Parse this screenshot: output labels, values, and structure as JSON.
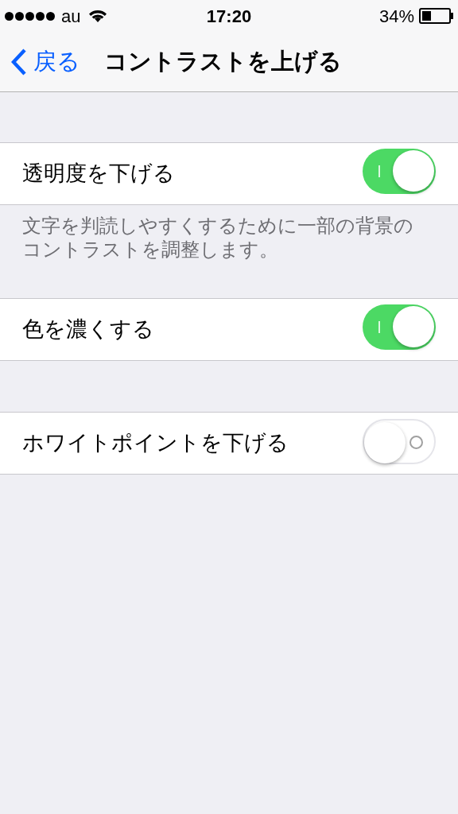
{
  "status_bar": {
    "carrier": "au",
    "time": "17:20",
    "battery": "34%"
  },
  "nav": {
    "back": "戻る",
    "title": "コントラストを上げる"
  },
  "sections": [
    {
      "rows": [
        {
          "label": "透明度を下げる",
          "on": true
        }
      ],
      "footer": "文字を判読しやすくするために一部の背景のコントラストを調整します。"
    },
    {
      "rows": [
        {
          "label": "色を濃くする",
          "on": true
        }
      ]
    },
    {
      "rows": [
        {
          "label": "ホワイトポイントを下げる",
          "on": false
        }
      ]
    }
  ]
}
